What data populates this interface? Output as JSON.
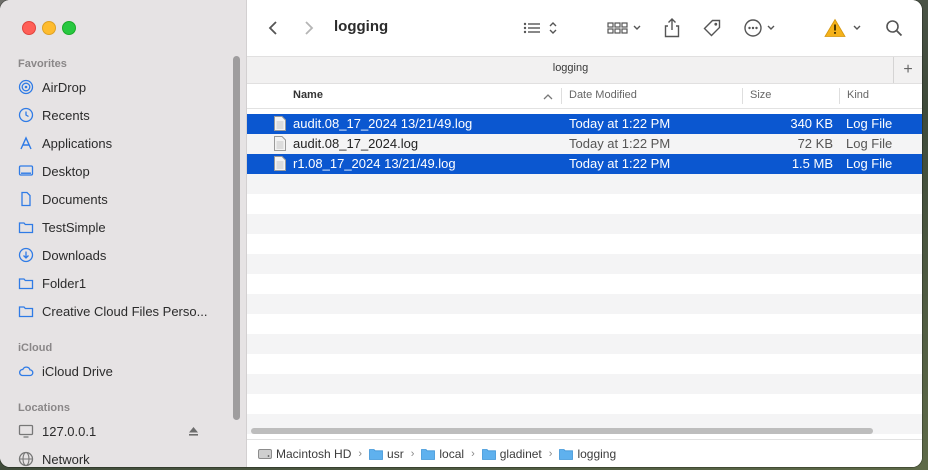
{
  "window": {
    "title": "logging",
    "path_header": "logging"
  },
  "sidebar": {
    "favorites_label": "Favorites",
    "favorites": [
      {
        "label": "AirDrop",
        "icon": "airdrop-icon"
      },
      {
        "label": "Recents",
        "icon": "clock-icon"
      },
      {
        "label": "Applications",
        "icon": "applications-icon"
      },
      {
        "label": "Desktop",
        "icon": "desktop-icon"
      },
      {
        "label": "Documents",
        "icon": "document-icon"
      },
      {
        "label": "TestSimple",
        "icon": "folder-icon"
      },
      {
        "label": "Downloads",
        "icon": "download-icon"
      },
      {
        "label": "Folder1",
        "icon": "folder-icon"
      },
      {
        "label": "Creative Cloud Files Perso...",
        "icon": "folder-icon"
      }
    ],
    "icloud_label": "iCloud",
    "icloud": [
      {
        "label": "iCloud Drive",
        "icon": "cloud-icon"
      }
    ],
    "locations_label": "Locations",
    "locations": [
      {
        "label": "127.0.0.1",
        "icon": "monitor-icon"
      },
      {
        "label": "Network",
        "icon": "network-icon"
      }
    ]
  },
  "columns": {
    "name": "Name",
    "date": "Date Modified",
    "size": "Size",
    "kind": "Kind"
  },
  "files": [
    {
      "name": "audit.08_17_2024 13/21/49.log",
      "date": "Today at 1:22 PM",
      "size": "340 KB",
      "kind": "Log File",
      "selected": true
    },
    {
      "name": "audit.08_17_2024.log",
      "date": "Today at 1:22 PM",
      "size": "72 KB",
      "kind": "Log File",
      "selected": false
    },
    {
      "name": "r1.08_17_2024 13/21/49.log",
      "date": "Today at 1:22 PM",
      "size": "1.5 MB",
      "kind": "Log File",
      "selected": true
    }
  ],
  "pathbar": [
    {
      "label": "Macintosh HD",
      "icon": "hard-drive-icon"
    },
    {
      "label": "usr",
      "icon": "folder-icon"
    },
    {
      "label": "local",
      "icon": "folder-icon"
    },
    {
      "label": "gladinet",
      "icon": "folder-icon"
    },
    {
      "label": "logging",
      "icon": "folder-icon"
    }
  ],
  "colors": {
    "accent": "#0b57d0",
    "sidebar_icon": "#2f7be6"
  }
}
